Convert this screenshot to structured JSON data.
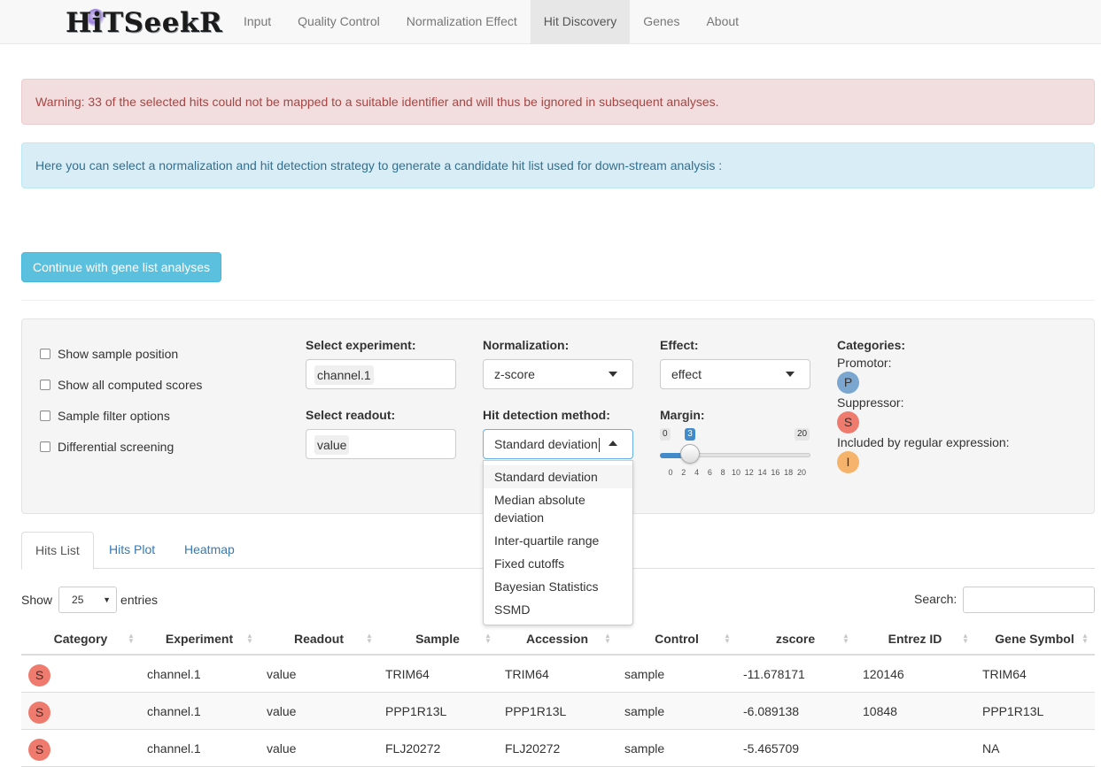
{
  "app": {
    "logo_text": "HiTSeekR"
  },
  "nav": {
    "items": [
      {
        "label": "Input"
      },
      {
        "label": "Quality Control"
      },
      {
        "label": "Normalization Effect"
      },
      {
        "label": "Hit Discovery"
      },
      {
        "label": "Genes"
      },
      {
        "label": "About"
      }
    ],
    "active": "Hit Discovery"
  },
  "alerts": {
    "warning": "Warning: 33 of the selected hits could not be mapped to a suitable identifier and will thus be ignored in subsequent analyses.",
    "info": "Here you can select a normalization and hit detection strategy to generate a candidate hit list used for down-stream analysis :"
  },
  "continue_button": "Continue with gene list analyses",
  "options": {
    "checkboxes": [
      {
        "label": "Show sample position",
        "checked": false
      },
      {
        "label": "Show all computed scores",
        "checked": false
      },
      {
        "label": "Sample filter options",
        "checked": false
      },
      {
        "label": "Differential screening",
        "checked": false
      }
    ]
  },
  "controls": {
    "experiment": {
      "label": "Select experiment:",
      "value": "channel.1"
    },
    "readout": {
      "label": "Select readout:",
      "value": "value"
    },
    "normalization": {
      "label": "Normalization:",
      "value": "z-score"
    },
    "hit_method": {
      "label": "Hit detection method:",
      "value": "Standard deviation",
      "options": [
        "Standard deviation",
        "Median absolute deviation",
        "Inter-quartile range",
        "Fixed cutoffs",
        "Bayesian Statistics",
        "SSMD"
      ]
    },
    "effect": {
      "label": "Effect:",
      "value": "effect"
    },
    "margin": {
      "label": "Margin:",
      "min": 0,
      "max": 20,
      "value": 3,
      "min_label": "0",
      "max_label": "20",
      "value_label": "3",
      "ticks": [
        "0",
        "2",
        "4",
        "6",
        "8",
        "10",
        "12",
        "14",
        "16",
        "18",
        "20"
      ]
    }
  },
  "categories": {
    "title": "Categories:",
    "items": [
      {
        "label": "Promotor:",
        "badge": "P",
        "color": "#7aa6d0"
      },
      {
        "label": "Suppressor:",
        "badge": "S",
        "color": "#ee7b6e"
      },
      {
        "label": "Included by regular expression:",
        "badge": "I",
        "color": "#f5b36b"
      }
    ]
  },
  "tabs": [
    {
      "label": "Hits List",
      "active": true
    },
    {
      "label": "Hits Plot",
      "active": false
    },
    {
      "label": "Heatmap",
      "active": false
    }
  ],
  "table_controls": {
    "show": "Show",
    "entries_value": "25",
    "entries": "entries",
    "search_label": "Search:"
  },
  "table": {
    "columns": [
      "Category",
      "Experiment",
      "Readout",
      "Sample",
      "Accession",
      "Control",
      "zscore",
      "Entrez ID",
      "Gene Symbol"
    ],
    "rows": [
      {
        "category": "S",
        "experiment": "channel.1",
        "readout": "value",
        "sample": "TRIM64",
        "accession": "TRIM64",
        "control": "sample",
        "zscore": "-11.678171",
        "entrez": "120146",
        "symbol": "TRIM64"
      },
      {
        "category": "S",
        "experiment": "channel.1",
        "readout": "value",
        "sample": "PPP1R13L",
        "accession": "PPP1R13L",
        "control": "sample",
        "zscore": "-6.089138",
        "entrez": "10848",
        "symbol": "PPP1R13L"
      },
      {
        "category": "S",
        "experiment": "channel.1",
        "readout": "value",
        "sample": "FLJ20272",
        "accession": "FLJ20272",
        "control": "sample",
        "zscore": "-5.465709",
        "entrez": "",
        "symbol": "NA"
      }
    ]
  }
}
